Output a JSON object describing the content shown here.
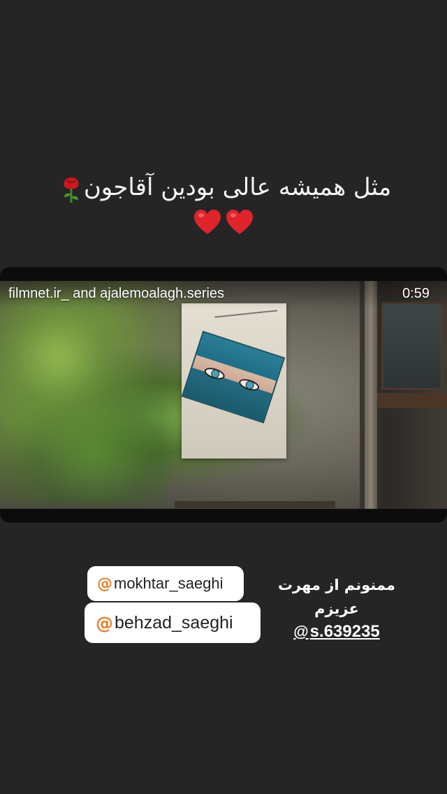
{
  "story": {
    "caption": "مثل همیشه عالی بودین آقاجون",
    "caption_emoji_icon": "rose-icon",
    "hearts": [
      "red-heart-icon",
      "red-heart-icon"
    ]
  },
  "video": {
    "source_text": "filmnet.ir_ and ajalemoalagh.series",
    "duration": "0:59"
  },
  "mentions": [
    {
      "at": "@",
      "handle": "mokhtar_saeghi"
    },
    {
      "at": "@",
      "handle": "behzad_saeghi"
    }
  ],
  "thanks": {
    "text": "ممنونم از مهرت عزیزم",
    "handle_icon": "threads-icon",
    "handle": "s.639235"
  },
  "colors": {
    "background": "#252525",
    "heart": "#e0242c",
    "mention_at": "#e8802a"
  }
}
